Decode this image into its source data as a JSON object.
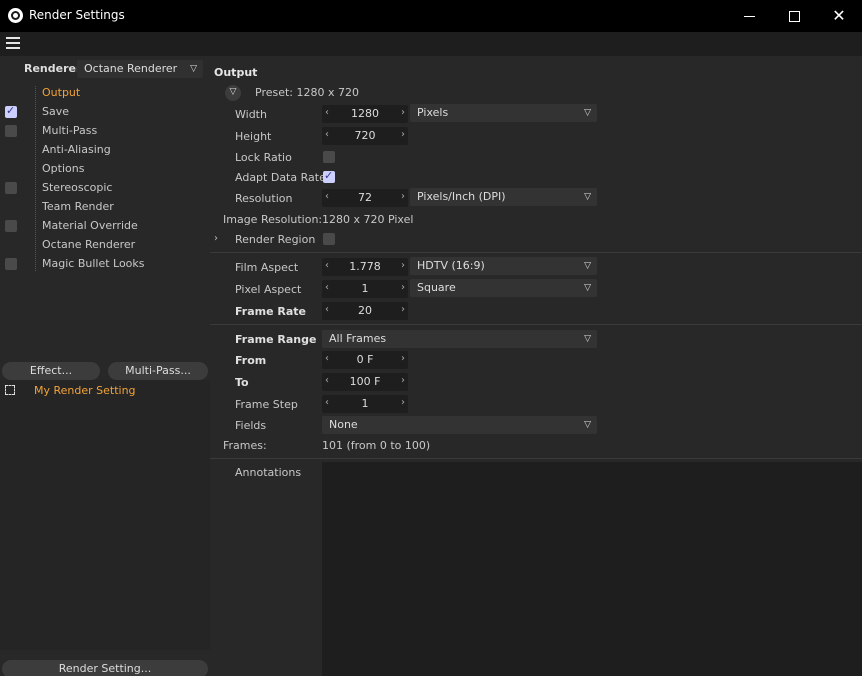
{
  "window": {
    "title": "Render Settings"
  },
  "sidebar": {
    "renderer_label": "Renderer",
    "renderer_value": "Octane Renderer",
    "items": [
      {
        "label": "Output",
        "checkbox": "none",
        "active": true
      },
      {
        "label": "Save",
        "checkbox": "checked"
      },
      {
        "label": "Multi-Pass",
        "checkbox": "unchecked"
      },
      {
        "label": "Anti-Aliasing",
        "checkbox": "none"
      },
      {
        "label": "Options",
        "checkbox": "none"
      },
      {
        "label": "Stereoscopic",
        "checkbox": "unchecked"
      },
      {
        "label": "Team Render",
        "checkbox": "none"
      },
      {
        "label": "Material Override",
        "checkbox": "unchecked"
      },
      {
        "label": "Octane Renderer",
        "checkbox": "none"
      },
      {
        "label": "Magic Bullet Looks",
        "checkbox": "unchecked"
      }
    ],
    "effect_button": "Effect...",
    "multipass_button": "Multi-Pass...",
    "render_setting_item": "My Render Setting",
    "render_setting_button": "Render Setting..."
  },
  "output": {
    "section_title": "Output",
    "preset": "Preset: 1280 x 720",
    "width_label": "Width",
    "width_value": "1280",
    "width_unit": "Pixels",
    "height_label": "Height",
    "height_value": "720",
    "lock_ratio_label": "Lock Ratio",
    "lock_ratio_checked": false,
    "adapt_rate_label": "Adapt Data Rate",
    "adapt_rate_checked": true,
    "resolution_label": "Resolution",
    "resolution_value": "72",
    "resolution_unit": "Pixels/Inch (DPI)",
    "image_resolution_label": "Image Resolution:",
    "image_resolution_value": "1280 x 720 Pixel",
    "render_region_label": "Render Region",
    "render_region_checked": false,
    "film_aspect_label": "Film Aspect",
    "film_aspect_value": "1.778",
    "film_aspect_preset": "HDTV (16:9)",
    "pixel_aspect_label": "Pixel Aspect",
    "pixel_aspect_value": "1",
    "pixel_aspect_preset": "Square",
    "frame_rate_label": "Frame Rate",
    "frame_rate_value": "20",
    "frame_range_label": "Frame Range",
    "frame_range_value": "All Frames",
    "from_label": "From",
    "from_value": "0 F",
    "to_label": "To",
    "to_value": "100 F",
    "frame_step_label": "Frame Step",
    "frame_step_value": "1",
    "fields_label": "Fields",
    "fields_value": "None",
    "frames_label": "Frames:",
    "frames_value": "101 (from 0 to 100)",
    "annotations_label": "Annotations"
  }
}
